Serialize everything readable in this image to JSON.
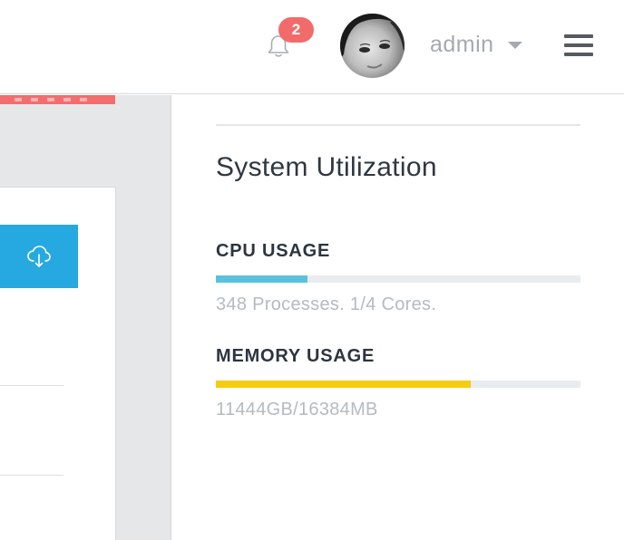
{
  "header": {
    "notification_count": "2",
    "username": "admin"
  },
  "system_utilization": {
    "title": "System Utilization",
    "cpu": {
      "label": "CPU USAGE",
      "percent": 25,
      "detail": "348 Processes. 1/4 Cores.",
      "bar_color": "#5bc0de"
    },
    "memory": {
      "label": "MEMORY USAGE",
      "percent": 70,
      "detail": "11444GB/16384MB",
      "bar_color": "#f5cc10"
    }
  },
  "colors": {
    "badge": "#f26b6b",
    "accent_stripe": "#f26d6d",
    "action_button": "#26a9e0"
  },
  "icons": {
    "notifications": "bell-icon",
    "action": "cloud-download-icon",
    "menu": "hamburger-menu-icon",
    "user_dropdown": "caret-down-icon"
  }
}
